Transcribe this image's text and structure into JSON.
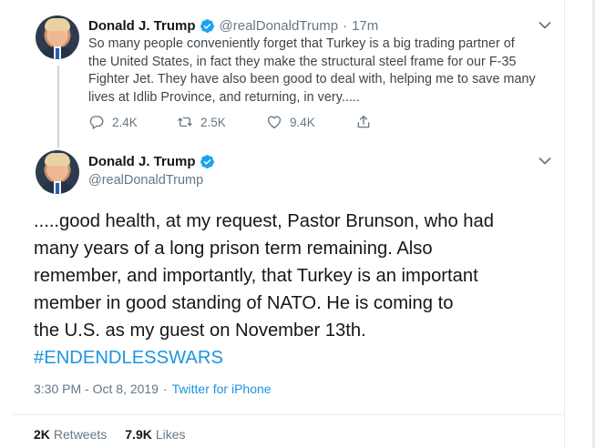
{
  "accent_color": "#1b95e0",
  "tweet1": {
    "display_name": "Donald J. Trump",
    "handle": "@realDonaldTrump",
    "separator": "·",
    "time": "17m",
    "text_lines": [
      "So many people conveniently forget that Turkey is a big trading partner of",
      "the United States, in fact they make the structural steel frame for our F-35",
      "Fighter Jet. They have also been good to deal with, helping me to save many",
      "lives at Idlib Province, and returning, in very....."
    ],
    "replies": "2.4K",
    "retweets": "2.5K",
    "likes": "9.4K",
    "icons": [
      "reply-icon",
      "retweet-icon",
      "like-icon",
      "share-icon",
      "chevron-down-icon",
      "verified-badge-icon"
    ]
  },
  "tweet2": {
    "display_name": "Donald J. Trump",
    "handle": "@realDonaldTrump",
    "text_lines": [
      ".....good health, at my request, Pastor Brunson, who had",
      "many years of a long prison term remaining. Also",
      "remember, and importantly, that Turkey is an important",
      "member in good standing of NATO. He is coming to",
      "the U.S. as my guest on November 13th."
    ],
    "hashtag": "#ENDENDLESSWARS",
    "timestamp": "3:30 PM - Oct 8, 2019",
    "meta_separator": "·",
    "source": "Twitter for iPhone",
    "retweets_count": "2K",
    "retweets_label": "Retweets",
    "likes_count": "7.9K",
    "likes_label": "Likes"
  }
}
